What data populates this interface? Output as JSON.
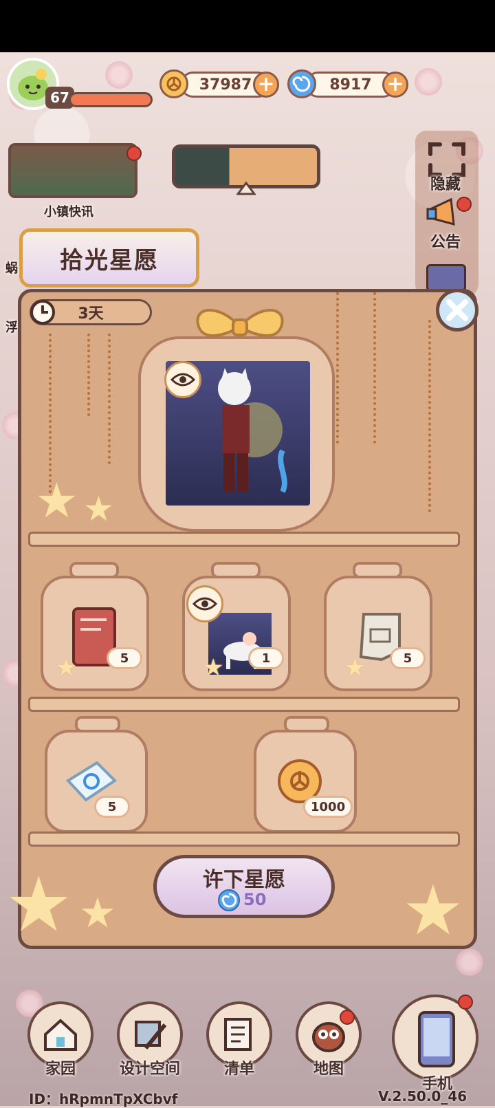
{
  "player": {
    "level": "67"
  },
  "currency": {
    "coins": {
      "value": "37987",
      "icon": "flower-coin-icon"
    },
    "gems": {
      "value": "8917",
      "icon": "swirl-gem-icon"
    }
  },
  "news": {
    "label": "小镇快讯"
  },
  "side_menu": {
    "hide_label": "隐藏",
    "notice_label": "公告"
  },
  "partial_left": {
    "item1": "蜗",
    "item2": "浮"
  },
  "event": {
    "title": "拾光星愿",
    "timer": "3天",
    "featured_reward": {
      "icon": "character-outfit-icon",
      "preview_icon": "eye-icon"
    },
    "rewards": [
      {
        "icon": "book-icon",
        "count": "5"
      },
      {
        "icon": "outfit-card-icon",
        "count": "1"
      },
      {
        "icon": "blueprint-scroll-icon",
        "count": "5"
      },
      {
        "icon": "ticket-icon",
        "count": "5"
      },
      {
        "icon": "flower-coin-icon",
        "count": "1000"
      }
    ],
    "wish_button": {
      "label": "许下星愿",
      "cost": "50",
      "cost_icon": "swirl-gem-icon"
    }
  },
  "bottom_nav": [
    {
      "label": "家园",
      "icon": "home-icon"
    },
    {
      "label": "设计空间",
      "icon": "design-tools-icon"
    },
    {
      "label": "清单",
      "icon": "checklist-icon"
    },
    {
      "label": "地图",
      "icon": "owl-map-icon"
    },
    {
      "label": "手机",
      "icon": "phone-icon"
    }
  ],
  "footer": {
    "id": "ID：hRpmnTpXCbvf",
    "version": "V.2.50.0_46"
  },
  "colors": {
    "accent_orange": "#f4a456",
    "panel": "#d9aa86",
    "button_lilac": "#e4d3ea",
    "gem_blue": "#3f8fe0"
  }
}
